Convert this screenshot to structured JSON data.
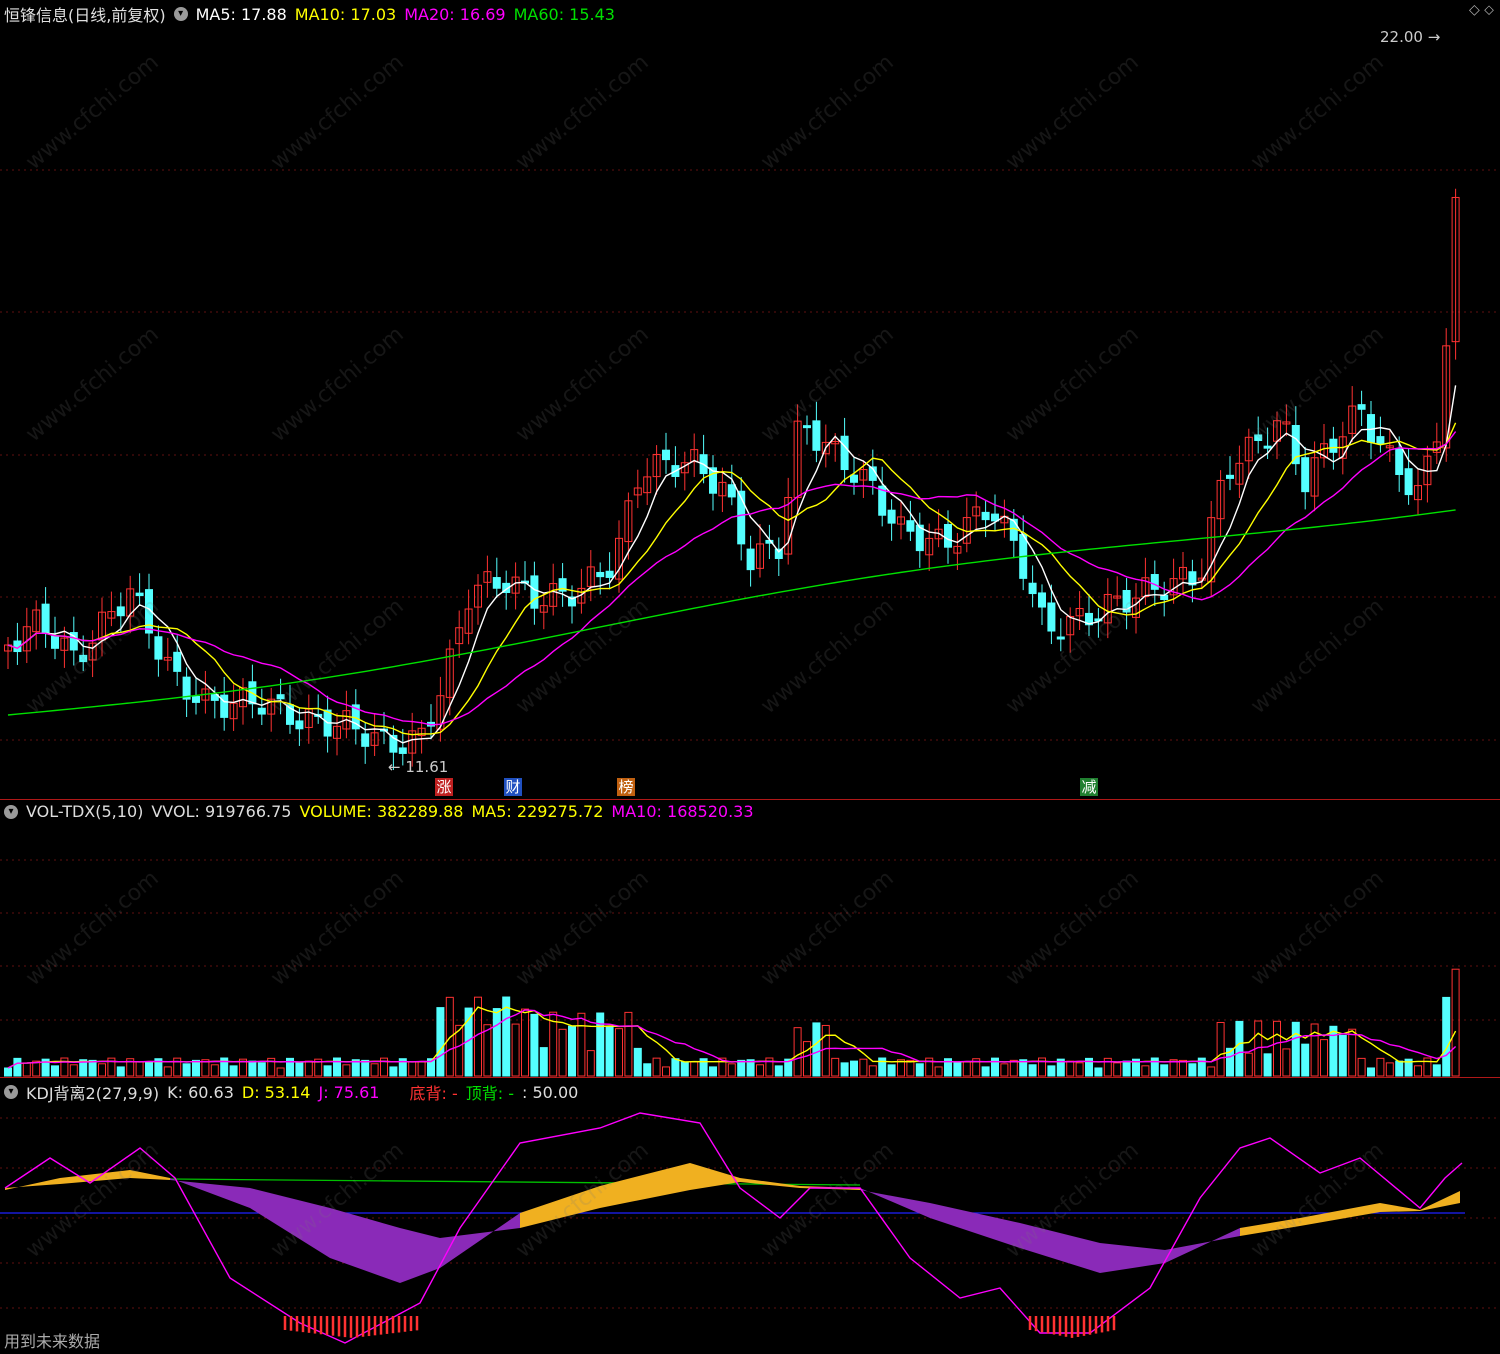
{
  "main": {
    "title": "恒锋信息(日线,前复权)",
    "ma5": "MA5: 17.88",
    "ma10": "MA10: 17.03",
    "ma20": "MA20: 16.69",
    "ma60": "MA60: 15.43",
    "high_label": "22.00",
    "low_label": "11.61",
    "tags": [
      "涨",
      "财",
      "榜",
      "减"
    ]
  },
  "vol": {
    "name": "VOL-TDX(5,10)",
    "vvol": "VVOL: 919766.75",
    "volume": "VOLUME: 382289.88",
    "ma5": "MA5: 229275.72",
    "ma10": "MA10: 168520.33"
  },
  "kdj": {
    "name": "KDJ背离2(27,9,9)",
    "k": "K: 60.63",
    "d": "D: 53.14",
    "j": "J: 75.61",
    "bottom": "底背: -",
    "top": "顶背: -",
    "level": ": 50.00"
  },
  "footer": "用到未来数据",
  "watermark": "www.cfchi.com",
  "colors": {
    "up": "#ff3232",
    "down": "#54ffff",
    "ma5": "#ffffff",
    "ma10": "#ffff00",
    "ma20": "#ff00ff",
    "ma60": "#00e000",
    "fill_up": "#f0b020",
    "fill_down": "#8a2ab8"
  }
}
